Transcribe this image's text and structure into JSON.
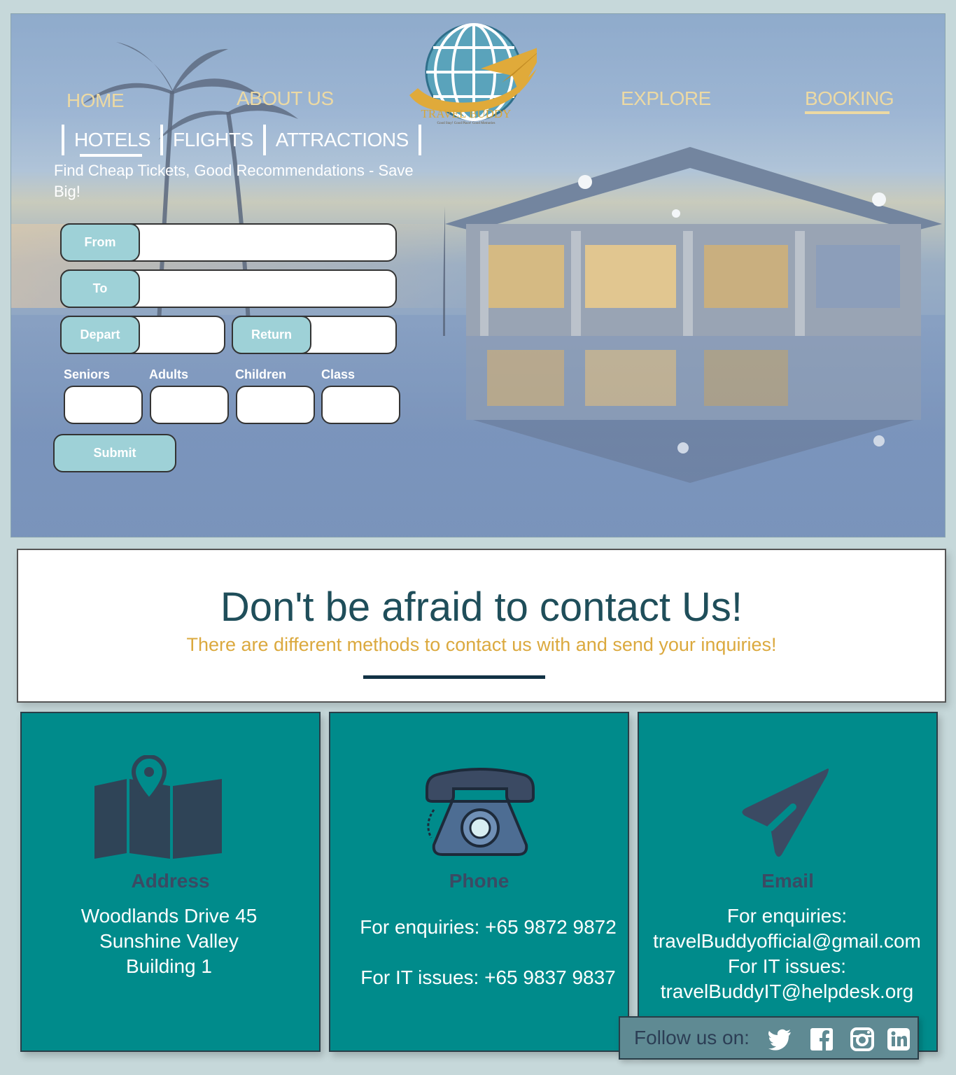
{
  "nav": {
    "home": "HOME",
    "about": "ABOUT US",
    "explore": "EXPLORE",
    "booking": "BOOKING",
    "active": "BOOKING"
  },
  "logo": {
    "title": "TRAVEL BUDDY",
    "tagline": "Good Stay! Good Place! Good Memories"
  },
  "tabs": {
    "hotels": "HOTELS",
    "flights": "FLIGHTS",
    "attractions": "ATTRACTIONS",
    "active": "HOTELS"
  },
  "tagline": "Find Cheap Tickets, Good Recommendations - Save Big!",
  "form": {
    "from_label": "From",
    "from_value": "",
    "to_label": "To",
    "to_value": "",
    "depart_label": "Depart",
    "depart_value": "",
    "return_label": "Return",
    "return_value": "",
    "seniors_label": "Seniors",
    "adults_label": "Adults",
    "children_label": "Children",
    "class_label": "Class",
    "submit_label": "Submit"
  },
  "contact": {
    "title": "Don't be afraid to contact Us!",
    "subtitle": "There are different methods to contact us with and send your inquiries!"
  },
  "cards": {
    "address": {
      "heading": "Address",
      "line1": "Woodlands Drive 45",
      "line2": "Sunshine Valley",
      "line3": "Building 1"
    },
    "phone": {
      "heading": "Phone",
      "line1": "For enquiries: +65 9872 9872",
      "line2": "For IT issues: +65 9837 9837"
    },
    "email": {
      "heading": "Email",
      "line1": "For enquiries:",
      "line2": "travelBuddyofficial@gmail.com",
      "line3": "For IT issues:",
      "line4": "travelBuddyIT@helpdesk.org"
    }
  },
  "follow": {
    "label": "Follow us on:",
    "icons": [
      "twitter-icon",
      "facebook-icon",
      "instagram-icon",
      "linkedin-icon"
    ]
  },
  "colors": {
    "teal_card": "#008b8b",
    "gold": "#dba93e",
    "nav_gold": "#ecd9a3",
    "field_label": "#9ed1d7",
    "dark_title": "#1f4e5a",
    "page_bg": "#c6d8da"
  }
}
